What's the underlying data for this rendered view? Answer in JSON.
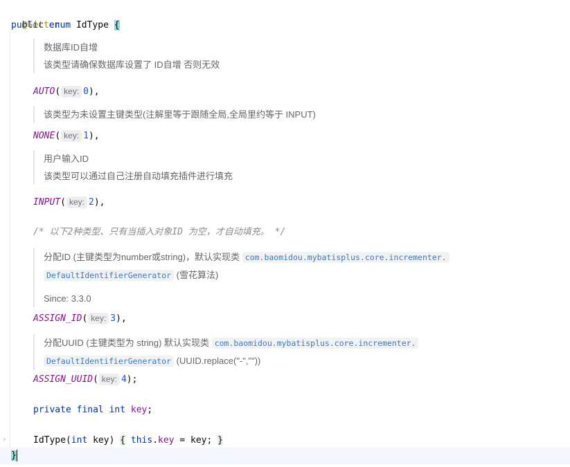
{
  "code": {
    "annotation": "@Getter",
    "enum_decl": {
      "public": "public",
      "enum": "enum",
      "name": "IdType",
      "open_brace": "{"
    },
    "auto": {
      "doc": [
        "数据库ID自增",
        "该类型请确保数据库设置了 ID自增 否则无效"
      ],
      "name": "AUTO",
      "hint": "key:",
      "value": "0",
      "end": "),"
    },
    "none": {
      "doc": [
        "该类型为未设置主键类型(注解里等于跟随全局,全局里约等于 INPUT)"
      ],
      "name": "NONE",
      "hint": "key:",
      "value": "1",
      "end": "),"
    },
    "input": {
      "doc": [
        "用户输入ID",
        "该类型可以通过自己注册自动填充插件进行填充"
      ],
      "name": "INPUT",
      "hint": "key:",
      "value": "2",
      "end": "),"
    },
    "block_comment": "/* 以下2种类型、只有当插入对象ID 为空，才自动填充。 */",
    "assign_id": {
      "doc_prefix": "分配ID (主键类型为number或string)，默认实现类",
      "doc_ref1": "com.baomidou.mybatisplus.core.incrementer.",
      "doc_ref2": "DefaultIdentifierGenerator",
      "doc_suffix": "(雪花算法)",
      "since": "Since: 3.3.0",
      "name": "ASSIGN_ID",
      "hint": "key:",
      "value": "3",
      "end": "),"
    },
    "assign_uuid": {
      "doc_prefix": "分配UUID (主键类型为 string) 默认实现类",
      "doc_ref1": "com.baomidou.mybatisplus.core.incrementer.",
      "doc_ref2": "DefaultIdentifierGenerator",
      "doc_suffix": "(UUID.replace(\"-\",\"\"))",
      "name": "ASSIGN_UUID",
      "hint": "key:",
      "value": "4",
      "end": ");"
    },
    "field_decl": {
      "private": "private",
      "final": "final",
      "type": "int",
      "name": "key",
      "end": ";"
    },
    "constructor": {
      "name": "IdType",
      "open": "(",
      "param_type": "int",
      "param": "key",
      "close": ")",
      "lbrace": "{",
      "this": "this",
      "dot": ".",
      "field": "key",
      "assign": " = key;",
      "rbrace": "}"
    },
    "closing_brace": "}"
  }
}
